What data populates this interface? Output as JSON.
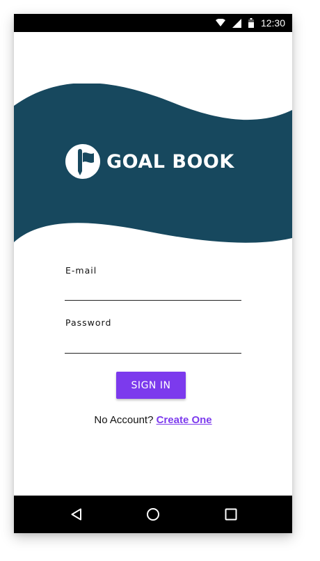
{
  "status_bar": {
    "time": "12:30",
    "icons": [
      "wifi-icon",
      "signal-icon",
      "battery-icon"
    ]
  },
  "header": {
    "app_name": "GOAL BOOK",
    "logo_icon": "flag-pencil-icon",
    "background_color": "#17485e"
  },
  "form": {
    "email_label": "E-mail",
    "email_value": "",
    "password_label": "Password",
    "password_value": "",
    "signin_label": "SIGN IN"
  },
  "account": {
    "prompt": "No Account?",
    "link_label": "Create One",
    "accent_color": "#7c3aed"
  },
  "nav_bar": {
    "icons": [
      "back-icon",
      "home-icon",
      "recents-icon"
    ]
  }
}
